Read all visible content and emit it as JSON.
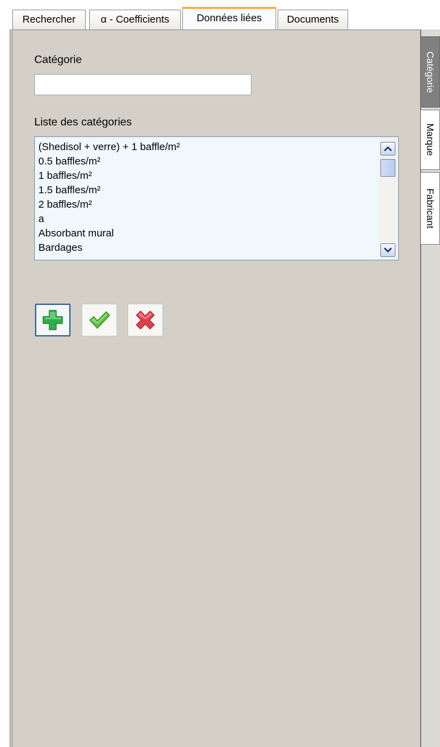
{
  "top_tabs": [
    {
      "label": "Rechercher"
    },
    {
      "label": "α - Coefficients"
    },
    {
      "label": "Données liées"
    },
    {
      "label": "Documents"
    }
  ],
  "active_top_tab": "Données liées",
  "side_tabs": [
    {
      "label": "Catégorie"
    },
    {
      "label": "Marque"
    },
    {
      "label": "Fabricant"
    }
  ],
  "active_side_tab": "Catégorie",
  "form": {
    "category_label": "Catégorie",
    "category_value": "",
    "list_label": "Liste des catégories",
    "list_items": [
      "(Shedisol + verre) + 1 baffle/m²",
      "0.5 baffles/m²",
      "1 baffles/m²",
      "1.5 baffles/m²",
      "2 baffles/m²",
      "a",
      "Absorbant mural",
      "Bardages"
    ]
  },
  "actions": [
    {
      "name": "add",
      "icon": "plus-icon",
      "color": "#2fae4a"
    },
    {
      "name": "confirm",
      "icon": "checkmark-icon",
      "color": "#5cbf3a"
    },
    {
      "name": "delete",
      "icon": "cross-icon",
      "color": "#e0404a"
    }
  ],
  "colors": {
    "panel": "#d4d0c8",
    "active_tab_accent": "#f5b040",
    "list_background": "#f0f8fe"
  }
}
